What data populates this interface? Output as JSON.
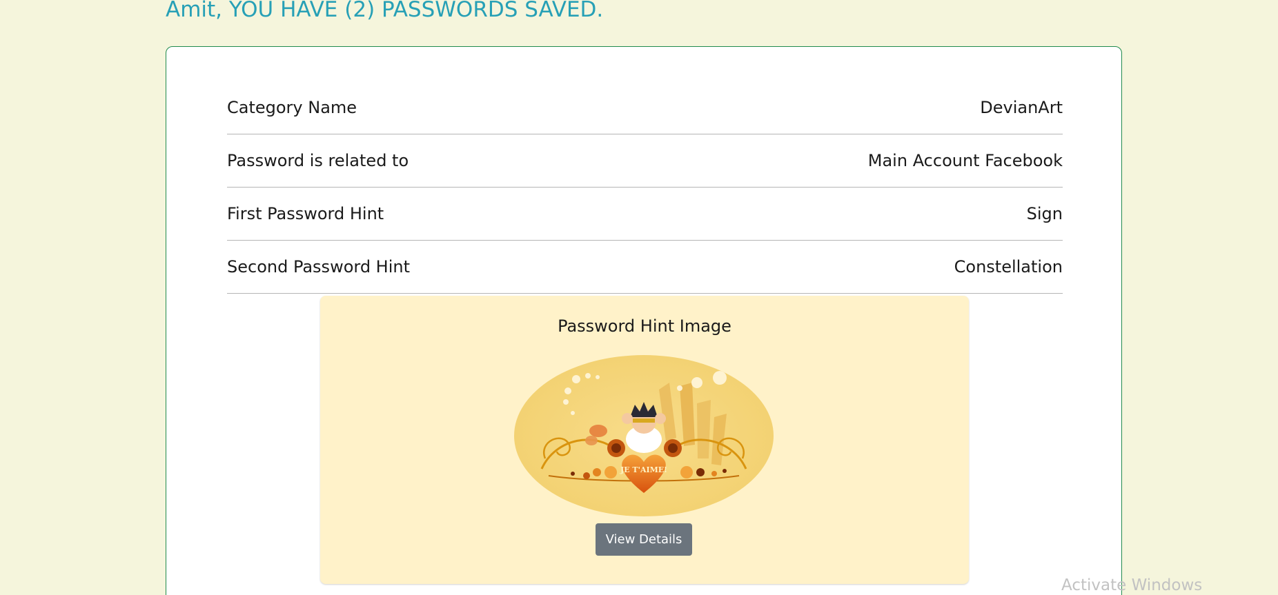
{
  "header": {
    "title": "Amit, YOU HAVE (2) PASSWORDS SAVED."
  },
  "details": [
    {
      "label": "Category Name",
      "value": "DevianArt"
    },
    {
      "label": "Password is related to",
      "value": "Main Account Facebook"
    },
    {
      "label": "First Password Hint",
      "value": "Sign"
    },
    {
      "label": "Second Password Hint",
      "value": "Constellation"
    }
  ],
  "hint_panel": {
    "title": "Password Hint Image",
    "image_text": "JE T'AIME!",
    "button_label": "View Details"
  },
  "watermark": "Activate Windows",
  "colors": {
    "page_background": "#f5f5dc",
    "heading": "#27a0b6",
    "card_border": "#1f8a4c",
    "panel_background": "#fff2c9",
    "button_background": "#6b747d"
  }
}
